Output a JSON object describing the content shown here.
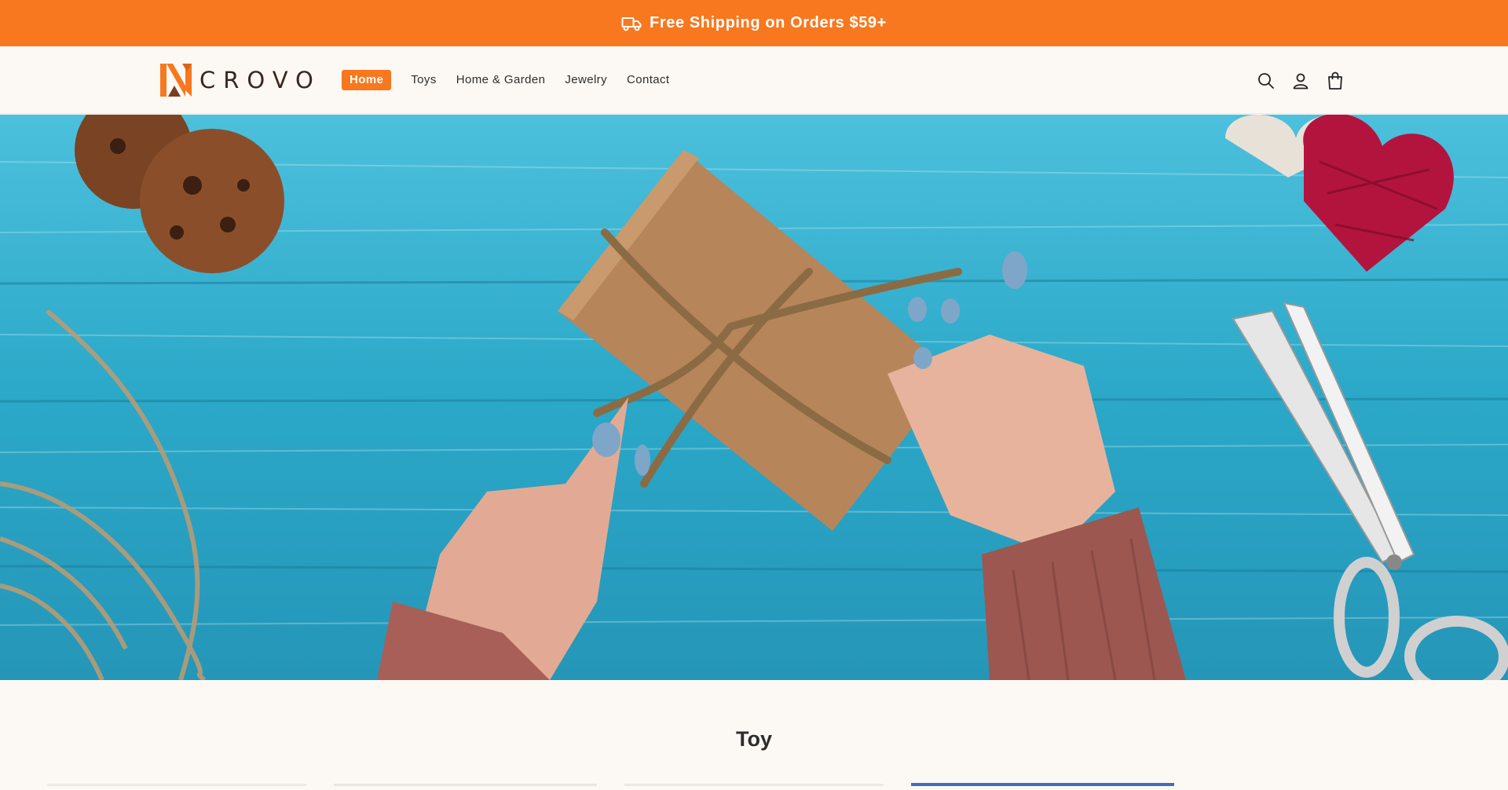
{
  "announcement": {
    "text": "Free Shipping on Orders $59+",
    "icon": "truck-icon"
  },
  "brand": {
    "name": "CROVO",
    "accent": "#f7781e",
    "dark": "#3a2620"
  },
  "nav": {
    "items": [
      {
        "label": "Home",
        "active": true
      },
      {
        "label": "Toys",
        "active": false
      },
      {
        "label": "Home & Garden",
        "active": false
      },
      {
        "label": "Jewelry",
        "active": false
      },
      {
        "label": "Contact",
        "active": false
      }
    ]
  },
  "header_icons": [
    "search-icon",
    "account-icon",
    "cart-icon"
  ],
  "section": {
    "title": "Toy"
  }
}
